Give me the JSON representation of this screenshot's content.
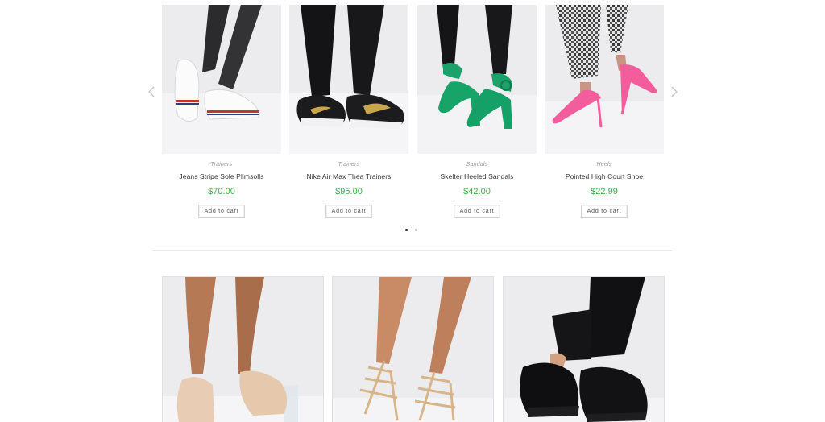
{
  "carousel": {
    "prev_icon": "chevron-left-icon",
    "next_icon": "chevron-right-icon",
    "products": [
      {
        "category": "Trainers",
        "name": "Jeans Stripe Sole Plimsolls",
        "price": "$70.00",
        "button": "Add to cart",
        "image": "white-plimsolls"
      },
      {
        "category": "Trainers",
        "name": "Nike Air Max Thea Trainers",
        "price": "$95.00",
        "button": "Add to cart",
        "image": "black-trainers"
      },
      {
        "category": "Sandals",
        "name": "Skelter Heeled Sandals",
        "price": "$42.00",
        "button": "Add to cart",
        "image": "green-heeled-sandals"
      },
      {
        "category": "Heels",
        "name": "Pointed High Court Shoe",
        "price": "$22.99",
        "button": "Add to cart",
        "image": "pink-court-shoes"
      }
    ],
    "pages": 2,
    "active_page": 1
  },
  "promos": [
    {
      "image": "clear-heel-sandals"
    },
    {
      "image": "gold-strappy-heels"
    },
    {
      "image": "black-platform-sneakers"
    }
  ],
  "colors": {
    "price": "#3fae49",
    "category": "#9b9b9b",
    "image_bg": "#efeff1"
  }
}
